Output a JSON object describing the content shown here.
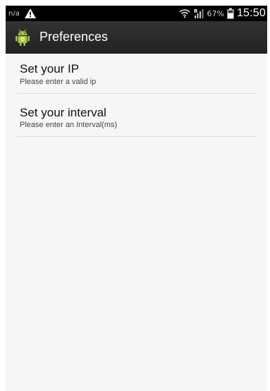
{
  "status_bar": {
    "carrier": "n/a",
    "battery_percent": "67%",
    "time": "15:50",
    "icons": [
      "warning-icon",
      "wifi-icon",
      "signal-icon",
      "battery-icon"
    ]
  },
  "action_bar": {
    "title": "Preferences",
    "icon": "android-app-icon"
  },
  "preferences": [
    {
      "title": "Set your IP",
      "summary": "Please enter a valid ip"
    },
    {
      "title": "Set your interval",
      "summary": "Please enter an Interval(ms)"
    }
  ],
  "colors": {
    "status_bar_bg": "#000000",
    "action_bar_bg": "#2a2a2a",
    "content_bg": "#f6f6f6",
    "android_green": "#a4c639"
  }
}
